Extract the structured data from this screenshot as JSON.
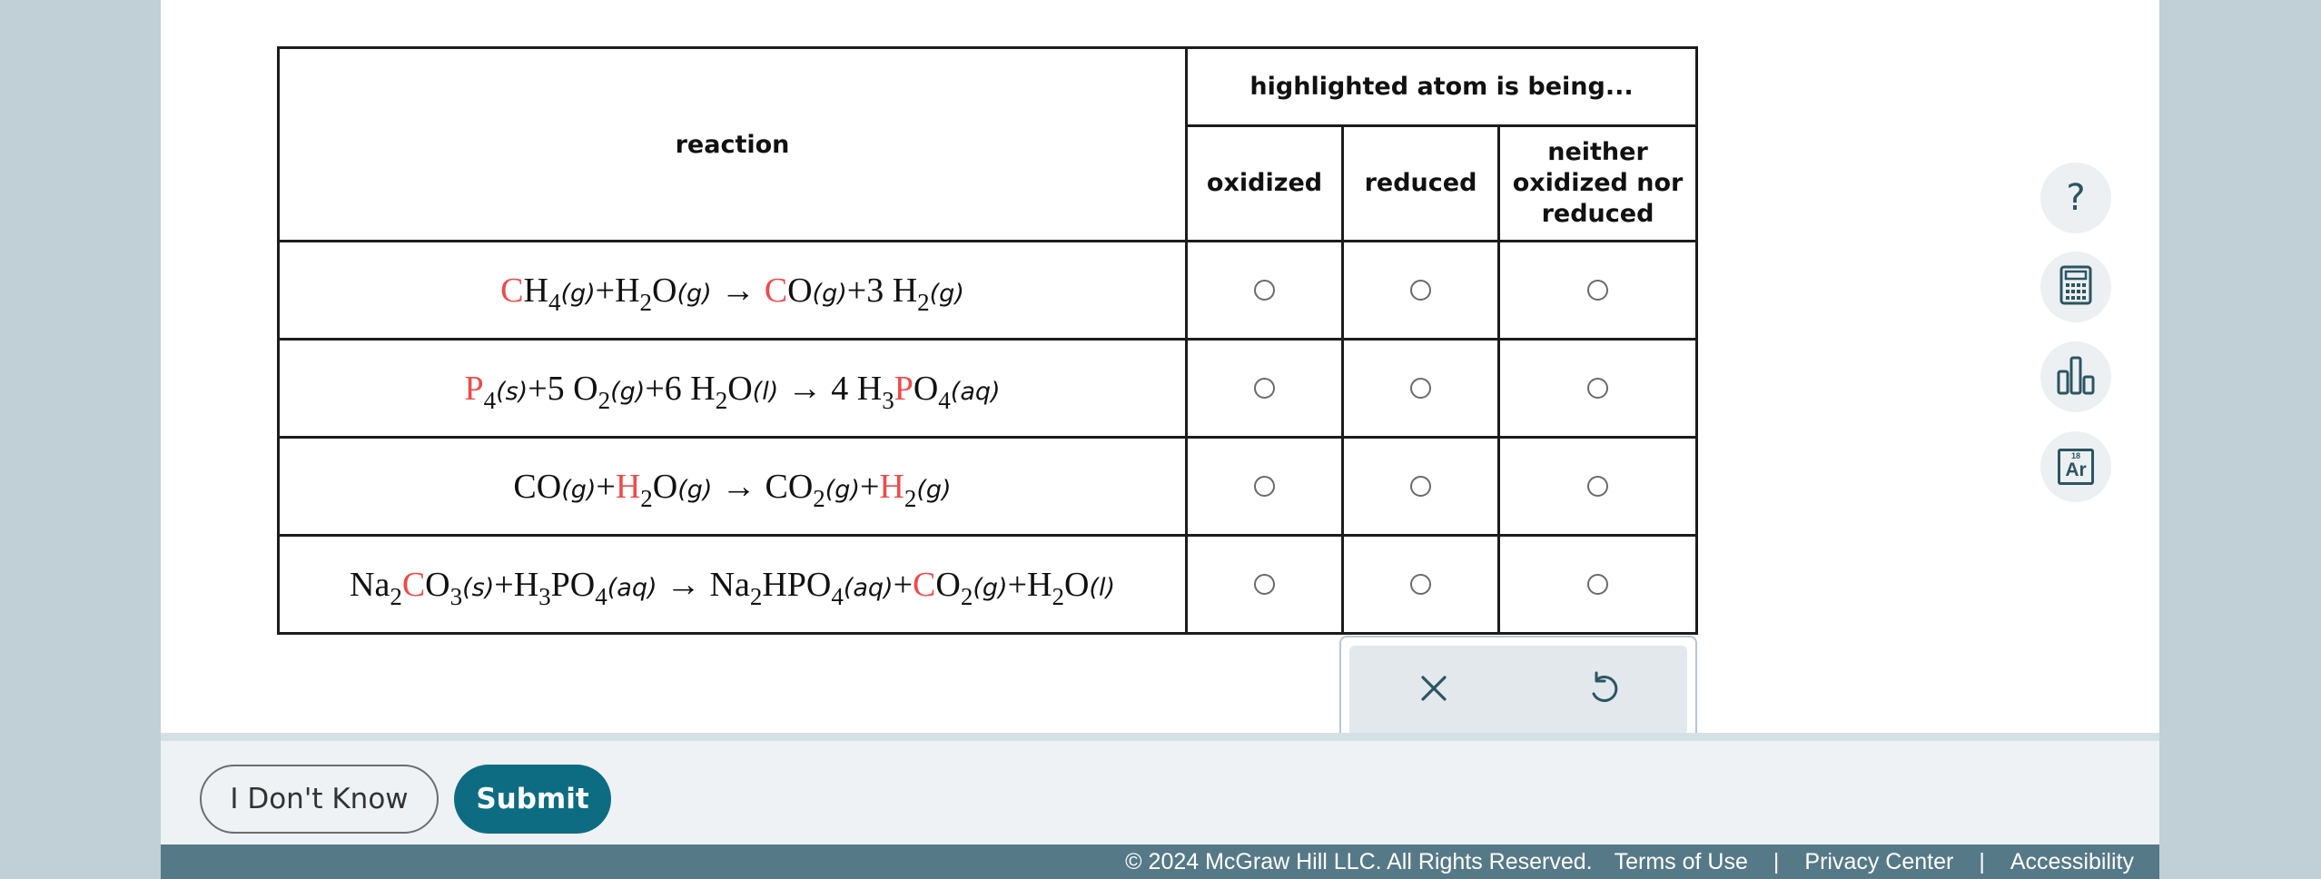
{
  "table": {
    "reaction_header": "reaction",
    "highlight_header": "highlighted atom is being...",
    "columns": [
      "oxidized",
      "reduced",
      "neither oxidized nor reduced"
    ],
    "rows": [
      {
        "id": "ch4"
      },
      {
        "id": "p4"
      },
      {
        "id": "co"
      },
      {
        "id": "na2co3"
      }
    ],
    "equation_text": {
      "r1": {
        "a": "C",
        "b": "H",
        "s1": "4",
        "p1": "(g)",
        "plus1": "+",
        "c": "H",
        "s2": "2",
        "d": "O",
        "p2": "(g)",
        "arrow": "→",
        "e": "C",
        "f": "O",
        "p3": "(g)",
        "plus2": "+",
        "g": "3 H",
        "s3": "2",
        "p4": "(g)"
      },
      "r2": {
        "a": "P",
        "s1": "4",
        "p1": "(s)",
        "plus1": "+",
        "b": "5 O",
        "s2": "2",
        "p2": "(g)",
        "plus2": "+",
        "c": "6 H",
        "s3": "2",
        "d": "O",
        "p3": "(l)",
        "arrow": "→",
        "e": "4 H",
        "s4": "3",
        "f": "P",
        "g": "O",
        "s5": "4",
        "p4": "(aq)"
      },
      "r3": {
        "a": "CO",
        "p1": "(g)",
        "plus1": "+",
        "b": "H",
        "s1": "2",
        "c": "O",
        "p2": "(g)",
        "arrow": "→",
        "d": "CO",
        "s2": "2",
        "p3": "(g)",
        "plus2": "+",
        "e": "H",
        "s3": "2",
        "p4": "(g)"
      },
      "r4": {
        "a": "Na",
        "s1": "2",
        "b": "C",
        "c": "O",
        "s2": "3",
        "p1": "(s)",
        "plus1": "+",
        "d": "H",
        "s3": "3",
        "e": "PO",
        "s4": "4",
        "p2": "(aq)",
        "arrow": "→",
        "f": "Na",
        "s5": "2",
        "g": "HPO",
        "s6": "4",
        "p3": "(aq)",
        "plus2": "+",
        "h": "C",
        "i": "O",
        "s7": "2",
        "p4": "(g)",
        "plus3": "+",
        "j": "H",
        "s8": "2",
        "k": "O",
        "p5": "(l)"
      }
    }
  },
  "colors": {
    "highlight": "#ee4b4b",
    "submit": "#0d6c82",
    "footer": "#557987"
  },
  "tools": [
    {
      "name": "help",
      "icon": "question-icon",
      "glyph": "?"
    },
    {
      "name": "calculator",
      "icon": "calculator-icon"
    },
    {
      "name": "data",
      "icon": "bar-chart-icon"
    },
    {
      "name": "periodic-table",
      "icon": "periodic-table-icon",
      "element": "Ar",
      "number": "18"
    }
  ],
  "actions": {
    "dont_know": "I Don't Know",
    "submit": "Submit"
  },
  "footer": {
    "copyright": "© 2024 McGraw Hill LLC. All Rights Reserved.",
    "terms": "Terms of Use",
    "privacy": "Privacy Center",
    "accessibility": "Accessibility",
    "sep": "|"
  }
}
